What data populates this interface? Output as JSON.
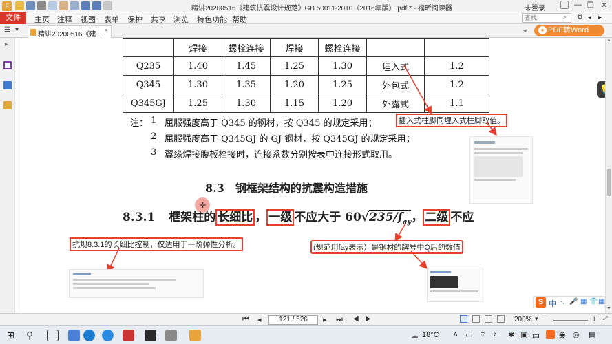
{
  "window": {
    "title": "精讲20200516《建筑抗震设计规范》GB 50011-2010（2016年版）.pdf * - 福昕阅读器",
    "login": "未登录",
    "minimize": "—",
    "restore": "❐",
    "close": "✕"
  },
  "menu": {
    "file": "文件",
    "items": [
      "主页",
      "注释",
      "视图",
      "表单",
      "保护",
      "共享",
      "浏览",
      "特色功能",
      "帮助"
    ],
    "search_placeholder": "查找"
  },
  "tab": {
    "label": "精讲20200516《建...",
    "close": "×"
  },
  "pdf_to_word": "PDF转Word",
  "table": {
    "header": [
      "焊接",
      "螺栓连接",
      "焊接",
      "螺栓连接"
    ],
    "rows": [
      {
        "grade": "Q235",
        "v": [
          "1.40",
          "1.45",
          "1.25",
          "1.30"
        ],
        "form": "埋入式",
        "f": "1.2"
      },
      {
        "grade": "Q345",
        "v": [
          "1.30",
          "1.35",
          "1.20",
          "1.25"
        ],
        "form": "外包式",
        "f": "1.2"
      },
      {
        "grade": "Q345GJ",
        "v": [
          "1.25",
          "1.30",
          "1.15",
          "1.20"
        ],
        "form": "外露式",
        "f": "1.1"
      }
    ]
  },
  "notes": {
    "label": "注：",
    "n1_num": "1",
    "n1": "屈服强度高于 Q345 的钢材，按 Q345 的规定采用；",
    "n2_num": "2",
    "n2": "屈服强度高于 Q345GJ 的 GJ 钢材，按 Q345GJ 的规定采用；",
    "n3_num": "3",
    "n3": "翼缘焊接腹板栓接时，连接系数分别按表中连接形式取用。"
  },
  "section_title": "8.3　钢框架结构的抗震构造措施",
  "clause": {
    "number": "8.3.1",
    "part1": "框架柱的",
    "box1": "长细比",
    "comma1": "，",
    "box2": "一级",
    "part2": "不应大于 60",
    "sqrt": "235/",
    "f": "f",
    "sub": "ay",
    "comma2": "，",
    "box3": "二级",
    "part3": "不应"
  },
  "annotations": {
    "a1": "插入式柱脚同埋入式柱脚取值。",
    "a2": "抗规8.3.1的长细比控制，仅适用于一阶弹性分析。",
    "a3": "(规范用fay表示）是钢材的牌号中Q后的数值"
  },
  "status": {
    "page": "121 / 526",
    "zoom": "200%"
  },
  "taskbar": {
    "weather_icon": "☁",
    "temperature": "18°C",
    "ime": "中"
  },
  "sogou": {
    "logo": "S",
    "items": [
      "中",
      "·,",
      "🎤",
      "▦",
      "👕",
      "▦"
    ]
  },
  "colors": {
    "annotation_red": "#e8402f",
    "app_orange": "#e8a33a",
    "file_menu_red": "#d9372b"
  }
}
